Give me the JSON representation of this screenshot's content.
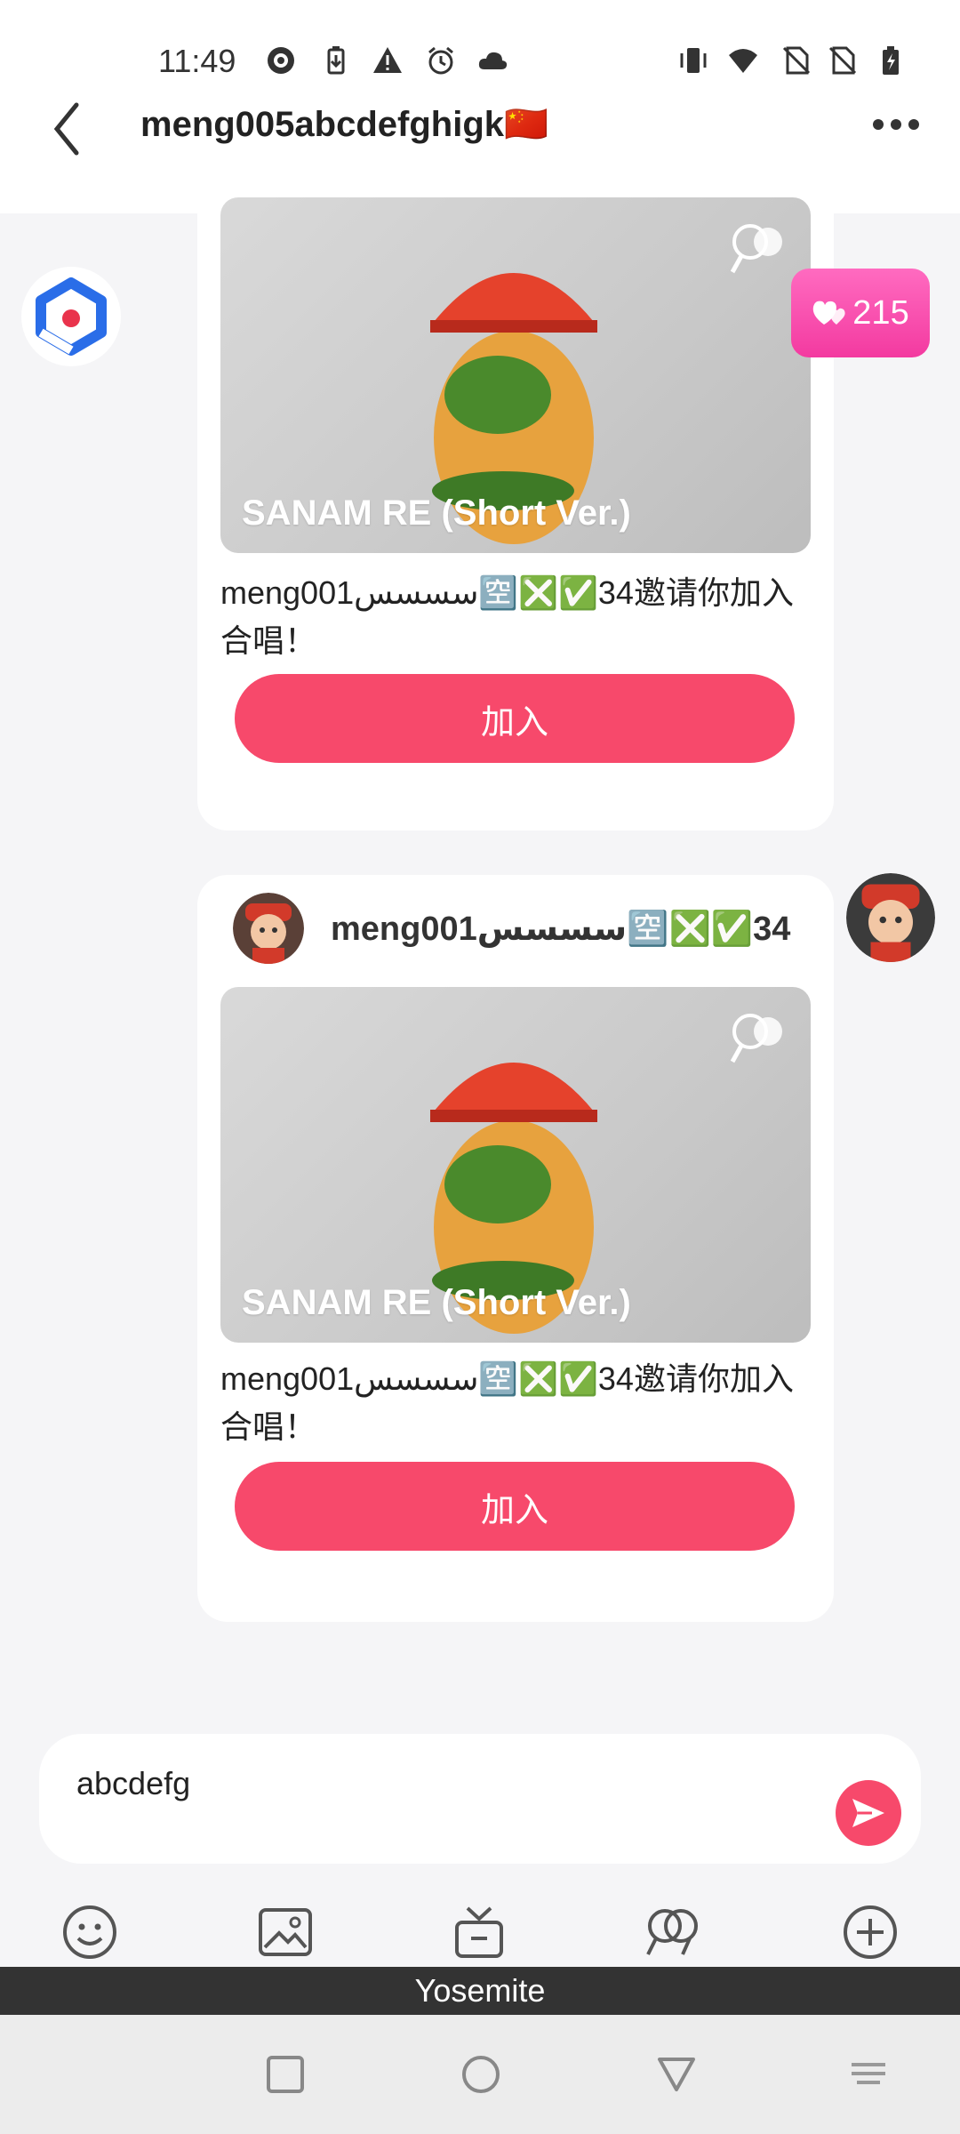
{
  "status_bar": {
    "time": "11:49",
    "icons": [
      "pocket-casts-icon",
      "battery-saver-icon",
      "warning-icon",
      "alarm-icon",
      "cloud-icon",
      "vibrate-icon",
      "wifi-icon",
      "no-sim-icon",
      "no-sim-icon",
      "battery-charging-icon"
    ]
  },
  "header": {
    "back_icon": "chevron-left-icon",
    "title": "meng005abcdefghigk🇨🇳",
    "more_icon": "more-horizontal-icon"
  },
  "colors": {
    "accent": "#f7496b",
    "like_badge": "#f55ab7",
    "background": "#f5f5f7"
  },
  "left_avatar": {
    "icon": "brand-logo-icon"
  },
  "like_badge": {
    "count": "215",
    "icon": "hearts-icon"
  },
  "messages": [
    {
      "song_title": "SANAM RE (Short Ver.)",
      "invite_text": "meng001سسسس🈳❎✅34邀请你加入合唱！",
      "join_label": "加入"
    },
    {
      "sender_name": "meng001سسسس🈳❎✅34",
      "song_title": "SANAM RE (Short Ver.)",
      "invite_text": "meng001سسسس🈳❎✅34邀请你加入合唱！",
      "join_label": "加入"
    }
  ],
  "composer": {
    "value": "abcdefg",
    "send_icon": "send-icon"
  },
  "toolbar": {
    "icons": [
      "emoji-icon",
      "image-icon",
      "gift-icon",
      "duet-mic-icon",
      "plus-circle-icon"
    ]
  },
  "ime_bar": {
    "label": "Yosemite"
  },
  "navbar": {
    "icons": [
      "recent-apps-icon",
      "home-icon",
      "back-triangle-icon",
      "keyboard-icon"
    ]
  }
}
